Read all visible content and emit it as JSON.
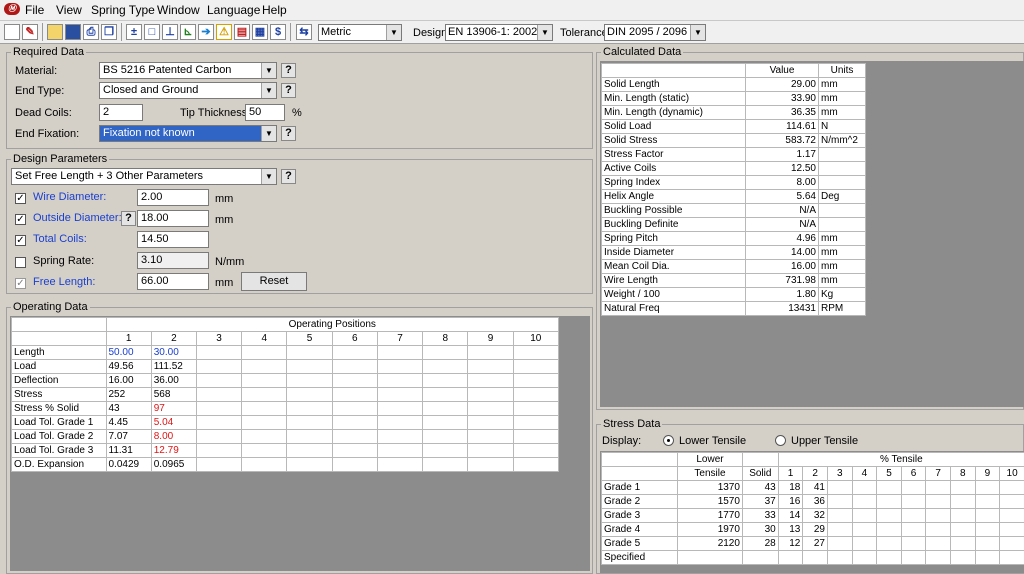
{
  "menu": {
    "logo": "Ⓜ",
    "items": [
      "File",
      "View",
      "Spring Type",
      "Window",
      "Language",
      "Help"
    ]
  },
  "toolbar": {
    "units": "Metric",
    "design_label": "Design:",
    "design_value": "EN 13906-1: 2002",
    "tolerance_label": "Tolerance:",
    "tolerance_value": "DIN 2095 / 2096",
    "dollar": "$",
    "units_icon": "⇆"
  },
  "required": {
    "title": "Required Data",
    "material_label": "Material:",
    "material_value": "BS 5216 Patented Carbon",
    "endtype_label": "End Type:",
    "endtype_value": "Closed and Ground",
    "deadcoils_label": "Dead Coils:",
    "deadcoils_value": "2",
    "tip_label": "Tip Thickness:",
    "tip_value": "50",
    "tip_unit": "%",
    "fixation_label": "End Fixation:",
    "fixation_value": "Fixation not known",
    "q": "?"
  },
  "design": {
    "title": "Design Parameters",
    "mode": "Set Free Length + 3 Other Parameters",
    "wire_label": "Wire Diameter:",
    "wire_value": "2.00",
    "wire_unit": "mm",
    "od_label": "Outside Diameter:",
    "od_value": "18.00",
    "od_unit": "mm",
    "coils_label": "Total Coils:",
    "coils_value": "14.50",
    "rate_label": "Spring Rate:",
    "rate_value": "3.10",
    "rate_unit": "N/mm",
    "free_label": "Free Length:",
    "free_value": "66.00",
    "free_unit": "mm",
    "reset": "Reset",
    "check": "✓",
    "q": "?"
  },
  "operating": {
    "title": "Operating Data",
    "positions_header": "Operating Positions",
    "cols": [
      "1",
      "2",
      "3",
      "4",
      "5",
      "6",
      "7",
      "8",
      "9",
      "10"
    ],
    "rows": [
      {
        "label": "Length",
        "v1": "50.00",
        "v2": "30.00"
      },
      {
        "label": "Load",
        "v1": "49.56",
        "v2": "111.52"
      },
      {
        "label": "Deflection",
        "v1": "16.00",
        "v2": "36.00"
      },
      {
        "label": "Stress",
        "v1": "252",
        "v2": "568"
      },
      {
        "label": "Stress % Solid",
        "v1": "43",
        "v2": "97"
      },
      {
        "label": "Load Tol. Grade 1",
        "v1": "4.45",
        "v2": "5.04"
      },
      {
        "label": "Load Tol. Grade 2",
        "v1": "7.07",
        "v2": "8.00"
      },
      {
        "label": "Load Tol. Grade 3",
        "v1": "11.31",
        "v2": "12.79"
      },
      {
        "label": "O.D. Expansion",
        "v1": "0.0429",
        "v2": "0.0965"
      }
    ]
  },
  "calculated": {
    "title": "Calculated Data",
    "h_value": "Value",
    "h_units": "Units",
    "rows": [
      {
        "label": "Solid Length",
        "value": "29.00",
        "unit": "mm"
      },
      {
        "label": "Min. Length (static)",
        "value": "33.90",
        "unit": "mm"
      },
      {
        "label": "Min. Length (dynamic)",
        "value": "36.35",
        "unit": "mm"
      },
      {
        "label": "Solid Load",
        "value": "114.61",
        "unit": "N"
      },
      {
        "label": "Solid Stress",
        "value": "583.72",
        "unit": "N/mm^2"
      },
      {
        "label": "Stress Factor",
        "value": "1.17",
        "unit": ""
      },
      {
        "label": "Active Coils",
        "value": "12.50",
        "unit": ""
      },
      {
        "label": "Spring Index",
        "value": "8.00",
        "unit": ""
      },
      {
        "label": "Helix Angle",
        "value": "5.64",
        "unit": "Deg"
      },
      {
        "label": "Buckling Possible",
        "value": "N/A",
        "unit": ""
      },
      {
        "label": "Buckling Definite",
        "value": "N/A",
        "unit": ""
      },
      {
        "label": "Spring Pitch",
        "value": "4.96",
        "unit": "mm"
      },
      {
        "label": "Inside Diameter",
        "value": "14.00",
        "unit": "mm"
      },
      {
        "label": "Mean Coil Dia.",
        "value": "16.00",
        "unit": "mm"
      },
      {
        "label": "Wire Length",
        "value": "731.98",
        "unit": "mm"
      },
      {
        "label": "Weight / 100",
        "value": "1.80",
        "unit": "Kg"
      },
      {
        "label": "Natural Freq",
        "value": "13431",
        "unit": "RPM"
      }
    ]
  },
  "stress": {
    "title": "Stress Data",
    "display_label": "Display:",
    "lower": "Lower Tensile",
    "upper": "Upper Tensile",
    "h_lower": "Lower",
    "h_tensile": "Tensile",
    "h_pct": "% Tensile",
    "h_solid": "Solid",
    "cols": [
      "1",
      "2",
      "3",
      "4",
      "5",
      "6",
      "7",
      "8",
      "9",
      "10"
    ],
    "rows": [
      {
        "label": "Grade 1",
        "tensile": "1370",
        "solid": "43",
        "p1": "18",
        "p2": "41"
      },
      {
        "label": "Grade 2",
        "tensile": "1570",
        "solid": "37",
        "p1": "16",
        "p2": "36"
      },
      {
        "label": "Grade 3",
        "tensile": "1770",
        "solid": "33",
        "p1": "14",
        "p2": "32"
      },
      {
        "label": "Grade 4",
        "tensile": "1970",
        "solid": "30",
        "p1": "13",
        "p2": "29"
      },
      {
        "label": "Grade 5",
        "tensile": "2120",
        "solid": "28",
        "p1": "12",
        "p2": "27"
      },
      {
        "label": "Specified",
        "tensile": "",
        "solid": "",
        "p1": "",
        "p2": ""
      }
    ]
  }
}
